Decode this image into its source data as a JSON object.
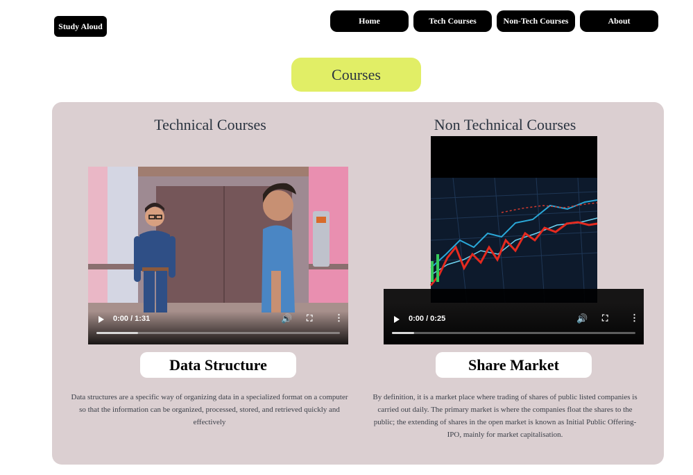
{
  "brand": {
    "label": "Study Aloud"
  },
  "nav": {
    "items": [
      "Home",
      "Tech Courses",
      "Non-Tech Courses",
      "About"
    ]
  },
  "page": {
    "heading": "Courses"
  },
  "technical": {
    "title": "Technical Courses",
    "video": {
      "time": "0:00 / 1:31",
      "progress": 0.17,
      "thumbnail": "elevator-animation"
    },
    "label": "Data Structure",
    "description": "Data structures are a specific way of organizing data in a specialized format on a computer so that the information can be organized, processed, stored, and retrieved quickly and effectively"
  },
  "nontechnical": {
    "title": "Non Technical Courses",
    "video": {
      "time": "0:00 / 0:25",
      "progress": 0.09,
      "thumbnail": "stock-chart"
    },
    "label": "Share Market",
    "description": "By definition, it is a market place where trading of shares of public listed companies is carried out daily. The primary market is where the companies float the shares to the public; the extending of shares in the open market is known as Initial Public Offering- IPO, mainly for market capitalisation."
  },
  "colors": {
    "accent": "#e1ee66",
    "panel": "#dbcfd1",
    "nav": "#000000"
  },
  "icons": {
    "play": "play-icon",
    "volume": "volume-icon",
    "fullscreen": "fullscreen-icon",
    "more": "more-icon"
  }
}
